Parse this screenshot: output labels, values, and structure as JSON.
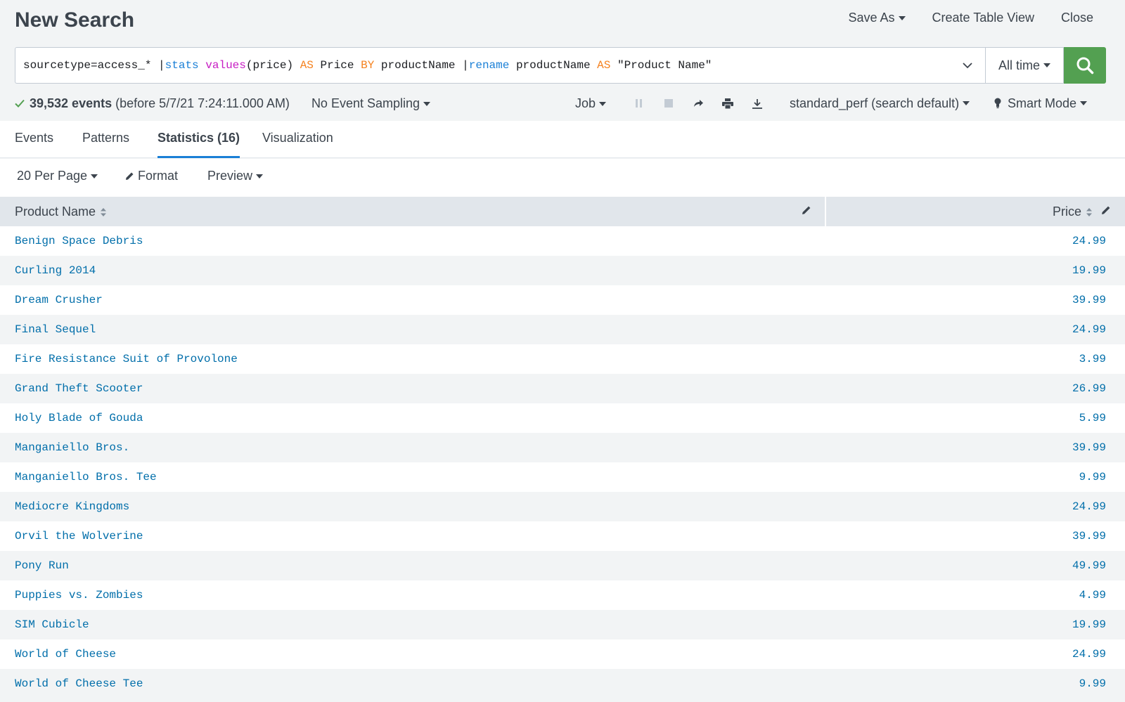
{
  "header": {
    "title": "New Search",
    "actions": {
      "save_as": "Save As",
      "create_table_view": "Create Table View",
      "close": "Close"
    }
  },
  "search": {
    "query": {
      "p1": "sourcetype=access_* |",
      "p2": "stats",
      "p3": " ",
      "p4": "values",
      "p5": "(price) ",
      "p6": "AS",
      "p7": " Price ",
      "p8": "BY",
      "p9": " productName |",
      "p10": "rename",
      "p11": " productName ",
      "p12": "AS",
      "p13": " \"Product Name\""
    },
    "time_range": "All time"
  },
  "status": {
    "event_count": "39,532 events",
    "before_text": "(before 5/7/21 7:24:11.000 AM)",
    "sampling": "No Event Sampling",
    "job": "Job",
    "perf_profile": "standard_perf (search default)",
    "mode": "Smart Mode"
  },
  "tabs": [
    {
      "label": "Events"
    },
    {
      "label": "Patterns"
    },
    {
      "label": "Statistics (16)"
    },
    {
      "label": "Visualization"
    }
  ],
  "toolbar": {
    "per_page": "20 Per Page",
    "format": "Format",
    "preview": "Preview"
  },
  "table": {
    "columns": [
      "Product Name",
      "Price"
    ],
    "rows": [
      {
        "name": "Benign Space Debris",
        "price": "24.99"
      },
      {
        "name": "Curling 2014",
        "price": "19.99"
      },
      {
        "name": "Dream Crusher",
        "price": "39.99"
      },
      {
        "name": "Final Sequel",
        "price": "24.99"
      },
      {
        "name": "Fire Resistance Suit of Provolone",
        "price": "3.99"
      },
      {
        "name": "Grand Theft Scooter",
        "price": "26.99"
      },
      {
        "name": "Holy Blade of Gouda",
        "price": "5.99"
      },
      {
        "name": "Manganiello Bros.",
        "price": "39.99"
      },
      {
        "name": "Manganiello Bros. Tee",
        "price": "9.99"
      },
      {
        "name": "Mediocre Kingdoms",
        "price": "24.99"
      },
      {
        "name": "Orvil the Wolverine",
        "price": "39.99"
      },
      {
        "name": "Pony Run",
        "price": "49.99"
      },
      {
        "name": "Puppies vs. Zombies",
        "price": "4.99"
      },
      {
        "name": "SIM Cubicle",
        "price": "19.99"
      },
      {
        "name": "World of Cheese",
        "price": "24.99"
      },
      {
        "name": "World of Cheese Tee",
        "price": "9.99"
      }
    ]
  },
  "colors": {
    "accent": "#1a7fd6",
    "search_button": "#53a051",
    "link": "#006eaa",
    "command": "#1a7fd6",
    "function": "#c71ec3",
    "keyword": "#f58220"
  },
  "icons": {
    "search": "search-icon",
    "expand": "chevron-down-icon",
    "check": "check-icon",
    "pause": "pause-icon",
    "stop": "stop-icon",
    "share": "share-icon",
    "print": "print-icon",
    "export": "export-icon",
    "mode": "lightbulb-icon",
    "format": "pencil-icon",
    "sort": "sort-icon",
    "edit": "edit-icon"
  }
}
